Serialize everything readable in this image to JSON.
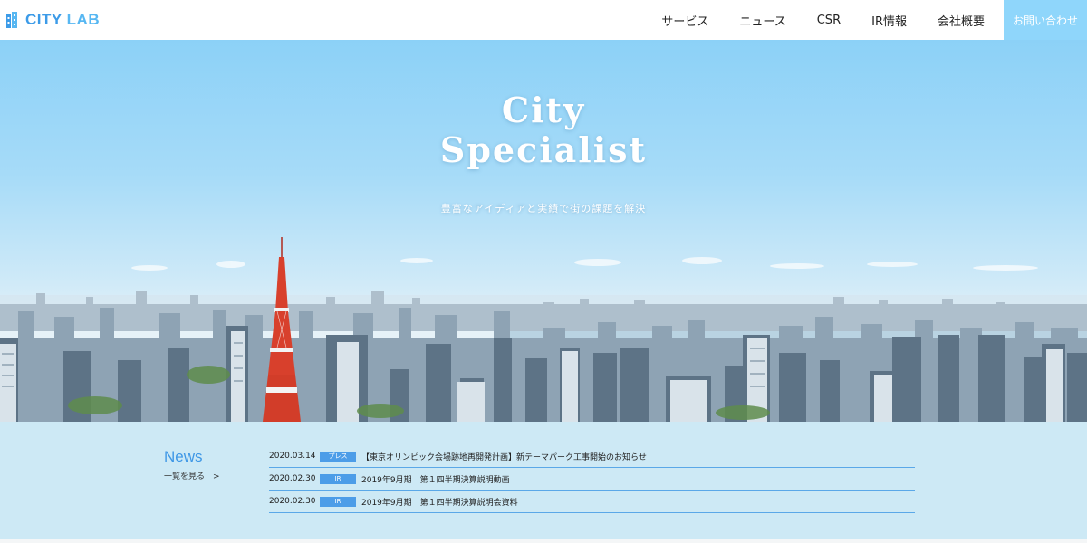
{
  "header": {
    "logo_city": "CITY",
    "logo_lab": "LAB",
    "nav": [
      {
        "label": "サービス"
      },
      {
        "label": "ニュース"
      },
      {
        "label": "CSR"
      },
      {
        "label": "IR情報"
      },
      {
        "label": "会社概要"
      }
    ],
    "contact_label": "お問い合わせ"
  },
  "hero": {
    "title_line1": "City",
    "title_line2": "Specialist",
    "subtitle": "豊富なアイディアと実績で街の課題を解決"
  },
  "news": {
    "heading": "News",
    "more_label": "一覧を見る　>",
    "items": [
      {
        "date": "2020.03.14",
        "tag": "プレス",
        "title": "【東京オリンピック会場跡地再開発計画】新テーマパーク工事開始のお知らせ"
      },
      {
        "date": "2020.02.30",
        "tag": "IR",
        "title": "2019年9月期　第１四半期決算説明動画"
      },
      {
        "date": "2020.02.30",
        "tag": "IR",
        "title": "2019年9月期　第１四半期決算説明会資料"
      }
    ]
  },
  "colors": {
    "brand_blue": "#3c9be8",
    "contact_bg": "#8fd6fb",
    "news_bg": "#cde9f5",
    "tag_bg": "#4c9de8"
  },
  "icons": {
    "logo": "building-icon",
    "news_more": "chevron-right"
  }
}
